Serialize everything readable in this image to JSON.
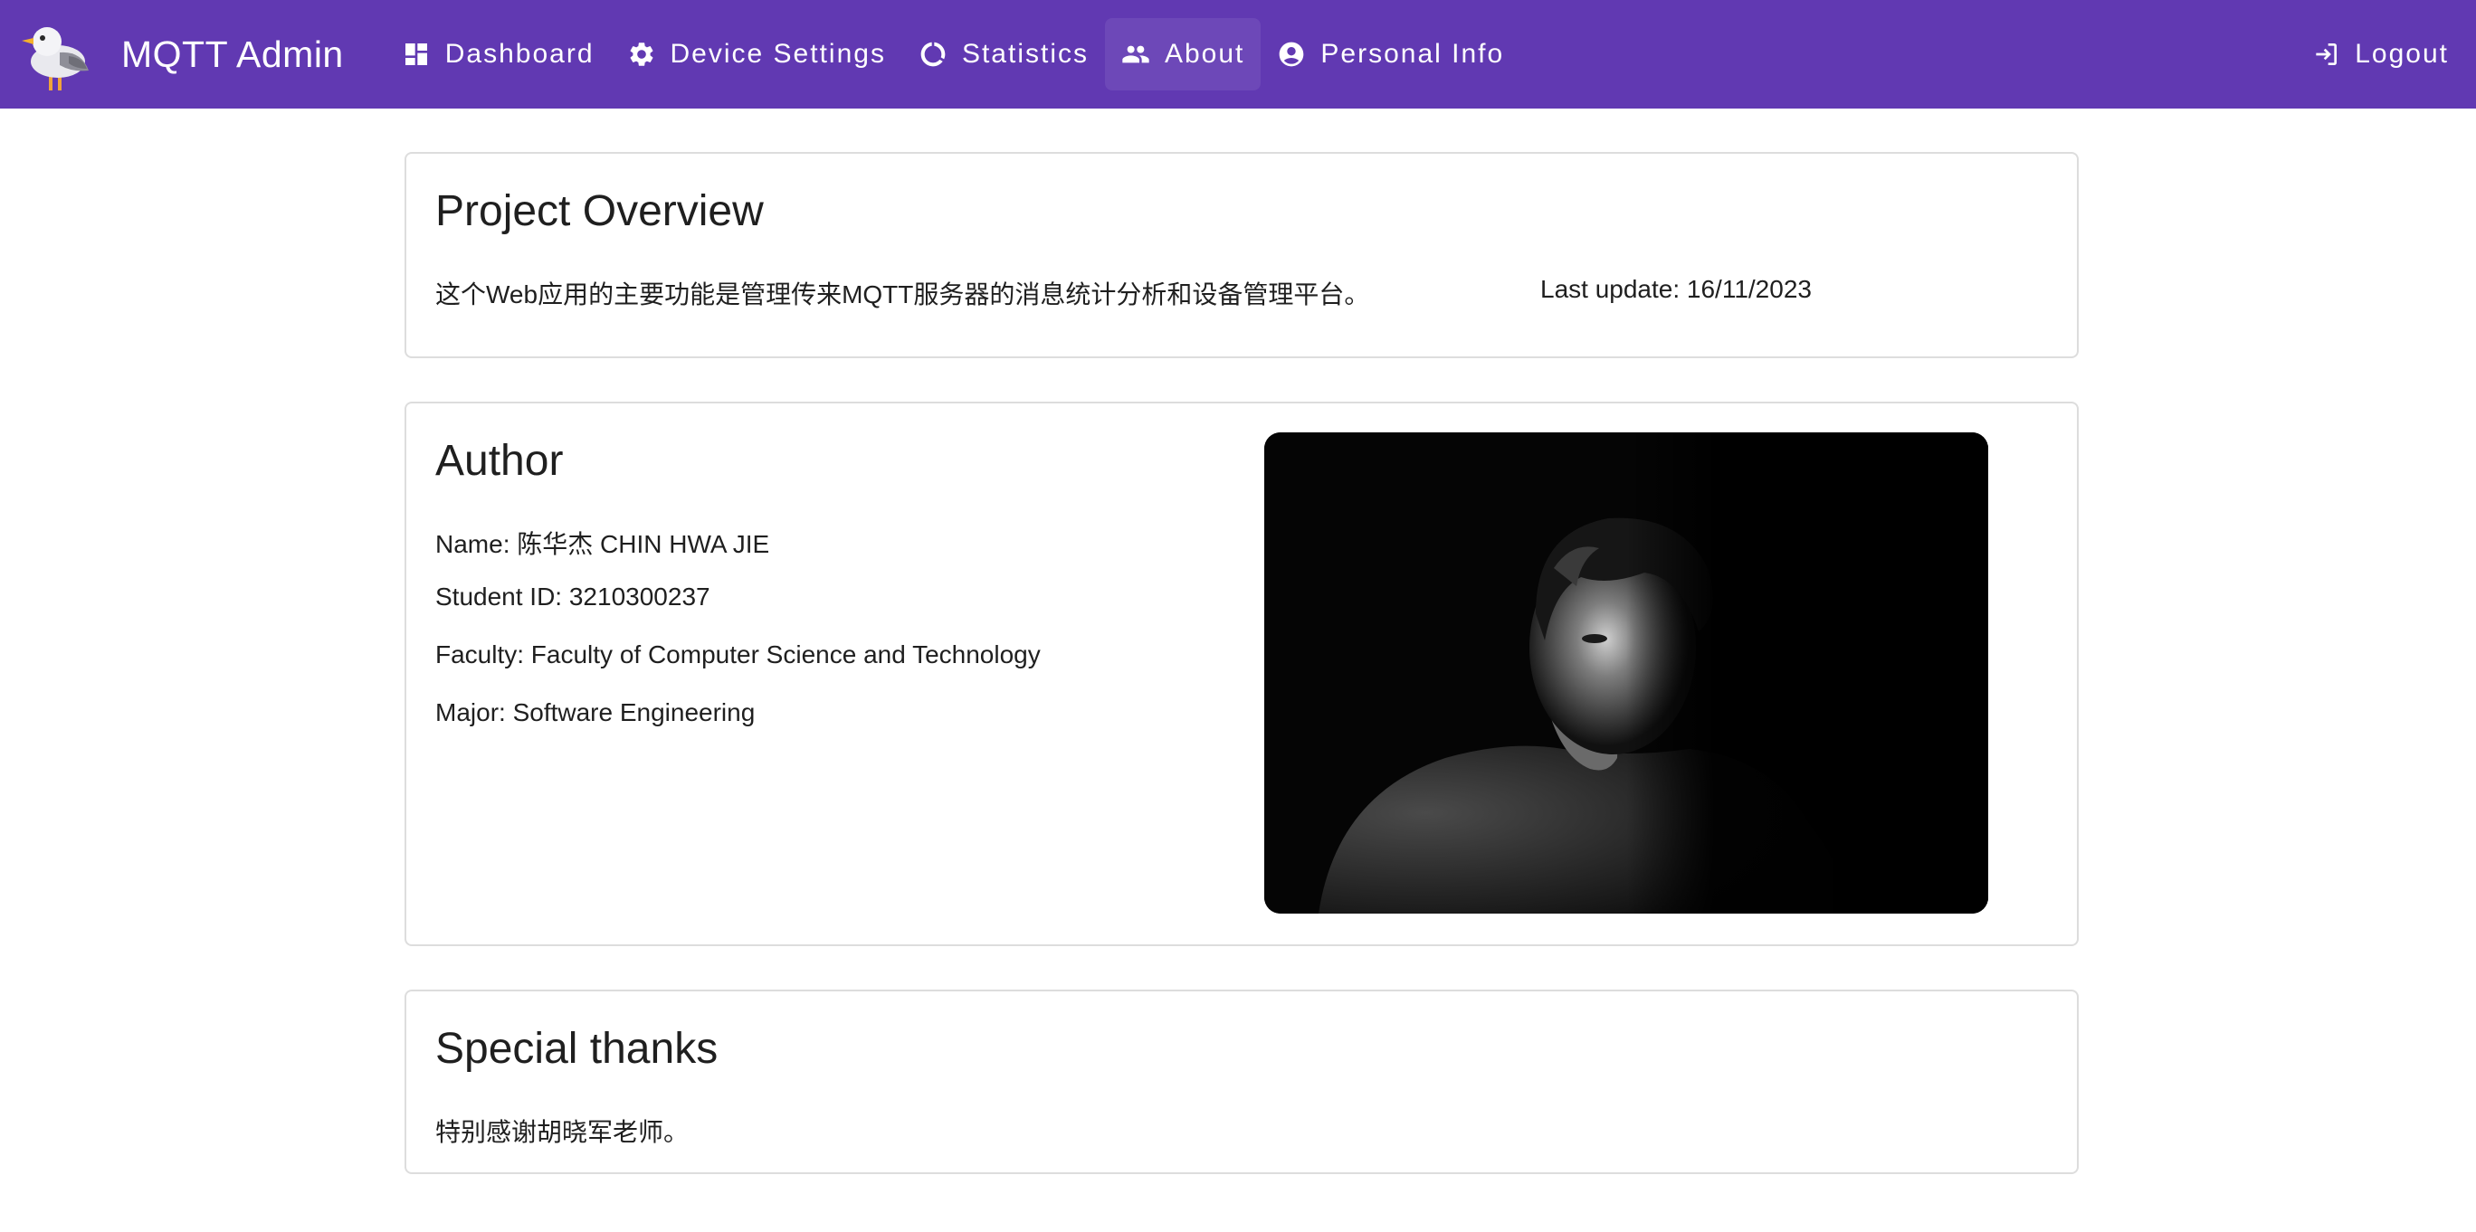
{
  "header": {
    "app_title": "MQTT Admin",
    "logo_icon": "seagull-logo",
    "nav": [
      {
        "label": "Dashboard",
        "icon": "dashboard-icon",
        "active": false
      },
      {
        "label": "Device Settings",
        "icon": "gear-icon",
        "active": false
      },
      {
        "label": "Statistics",
        "icon": "donut-chart-icon",
        "active": false
      },
      {
        "label": "About",
        "icon": "people-icon",
        "active": true
      },
      {
        "label": "Personal Info",
        "icon": "account-circle-icon",
        "active": false
      }
    ],
    "logout_label": "Logout",
    "logout_icon": "logout-icon",
    "background_color": "#6139b2"
  },
  "overview": {
    "title": "Project Overview",
    "description": "这个Web应用的主要功能是管理传来MQTT服务器的消息统计分析和设备管理平台。",
    "last_update": "Last update: 16/11/2023"
  },
  "author": {
    "title": "Author",
    "name": "Name: 陈华杰 CHIN HWA JIE",
    "student_id": "Student ID: 3210300237",
    "faculty": "Faculty: Faculty of Computer Science and Technology",
    "major": "Major: Software Engineering",
    "photo": "author-portrait-photo"
  },
  "thanks": {
    "title": "Special thanks",
    "text": "特别感谢胡晓军老师。"
  }
}
